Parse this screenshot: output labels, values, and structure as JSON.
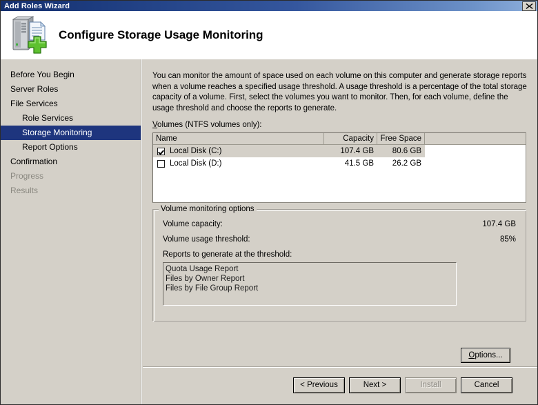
{
  "window": {
    "title": "Add Roles Wizard",
    "close_icon": "close-icon"
  },
  "header": {
    "title": "Configure Storage Usage Monitoring",
    "icon": "server-add-icon"
  },
  "sidebar": {
    "items": [
      {
        "label": "Before You Begin",
        "state": "normal",
        "indent": false
      },
      {
        "label": "Server Roles",
        "state": "normal",
        "indent": false
      },
      {
        "label": "File Services",
        "state": "normal",
        "indent": false
      },
      {
        "label": "Role Services",
        "state": "normal",
        "indent": true
      },
      {
        "label": "Storage Monitoring",
        "state": "selected",
        "indent": true
      },
      {
        "label": "Report Options",
        "state": "normal",
        "indent": true
      },
      {
        "label": "Confirmation",
        "state": "normal",
        "indent": false
      },
      {
        "label": "Progress",
        "state": "disabled",
        "indent": false
      },
      {
        "label": "Results",
        "state": "disabled",
        "indent": false
      }
    ]
  },
  "main": {
    "intro": "You can monitor the amount of space used on each volume on this computer and generate storage reports when a volume reaches a specified usage threshold.  A usage threshold is a percentage of the total storage capacity of a volume. First, select the volumes you want to monitor.  Then, for each volume, define the usage threshold and choose the reports to generate.",
    "volumes_label_accel": "V",
    "volumes_label_rest": "olumes (NTFS volumes only):",
    "table": {
      "columns": [
        "Name",
        "Capacity",
        "Free Space",
        ""
      ],
      "rows": [
        {
          "checked": true,
          "selected": true,
          "name": "Local Disk (C:)",
          "capacity": "107.4 GB",
          "free_space": "80.6 GB"
        },
        {
          "checked": false,
          "selected": false,
          "name": "Local Disk (D:)",
          "capacity": "41.5 GB",
          "free_space": "26.2 GB"
        }
      ]
    },
    "group": {
      "legend": "Volume monitoring options",
      "capacity_label": "Volume capacity:",
      "capacity_value": "107.4 GB",
      "threshold_label": "Volume usage threshold:",
      "threshold_value": "85%",
      "reports_label": "Reports to generate at the threshold:",
      "reports": [
        "Quota Usage Report",
        "Files by Owner Report",
        "Files by File Group Report"
      ],
      "options_button_accel": "O",
      "options_button_rest": "ptions..."
    }
  },
  "footer": {
    "buttons": [
      {
        "label": "< Previous",
        "enabled": true
      },
      {
        "label": "Next >",
        "enabled": true
      },
      {
        "label": "Install",
        "enabled": false
      },
      {
        "label": "Cancel",
        "enabled": true
      }
    ]
  },
  "colors": {
    "title_bar_start": "#15306e",
    "title_bar_end": "#8fb0dd",
    "dialog_face": "#d4d0c8",
    "selection": "#1e357e",
    "disabled_text": "#8a8880"
  }
}
